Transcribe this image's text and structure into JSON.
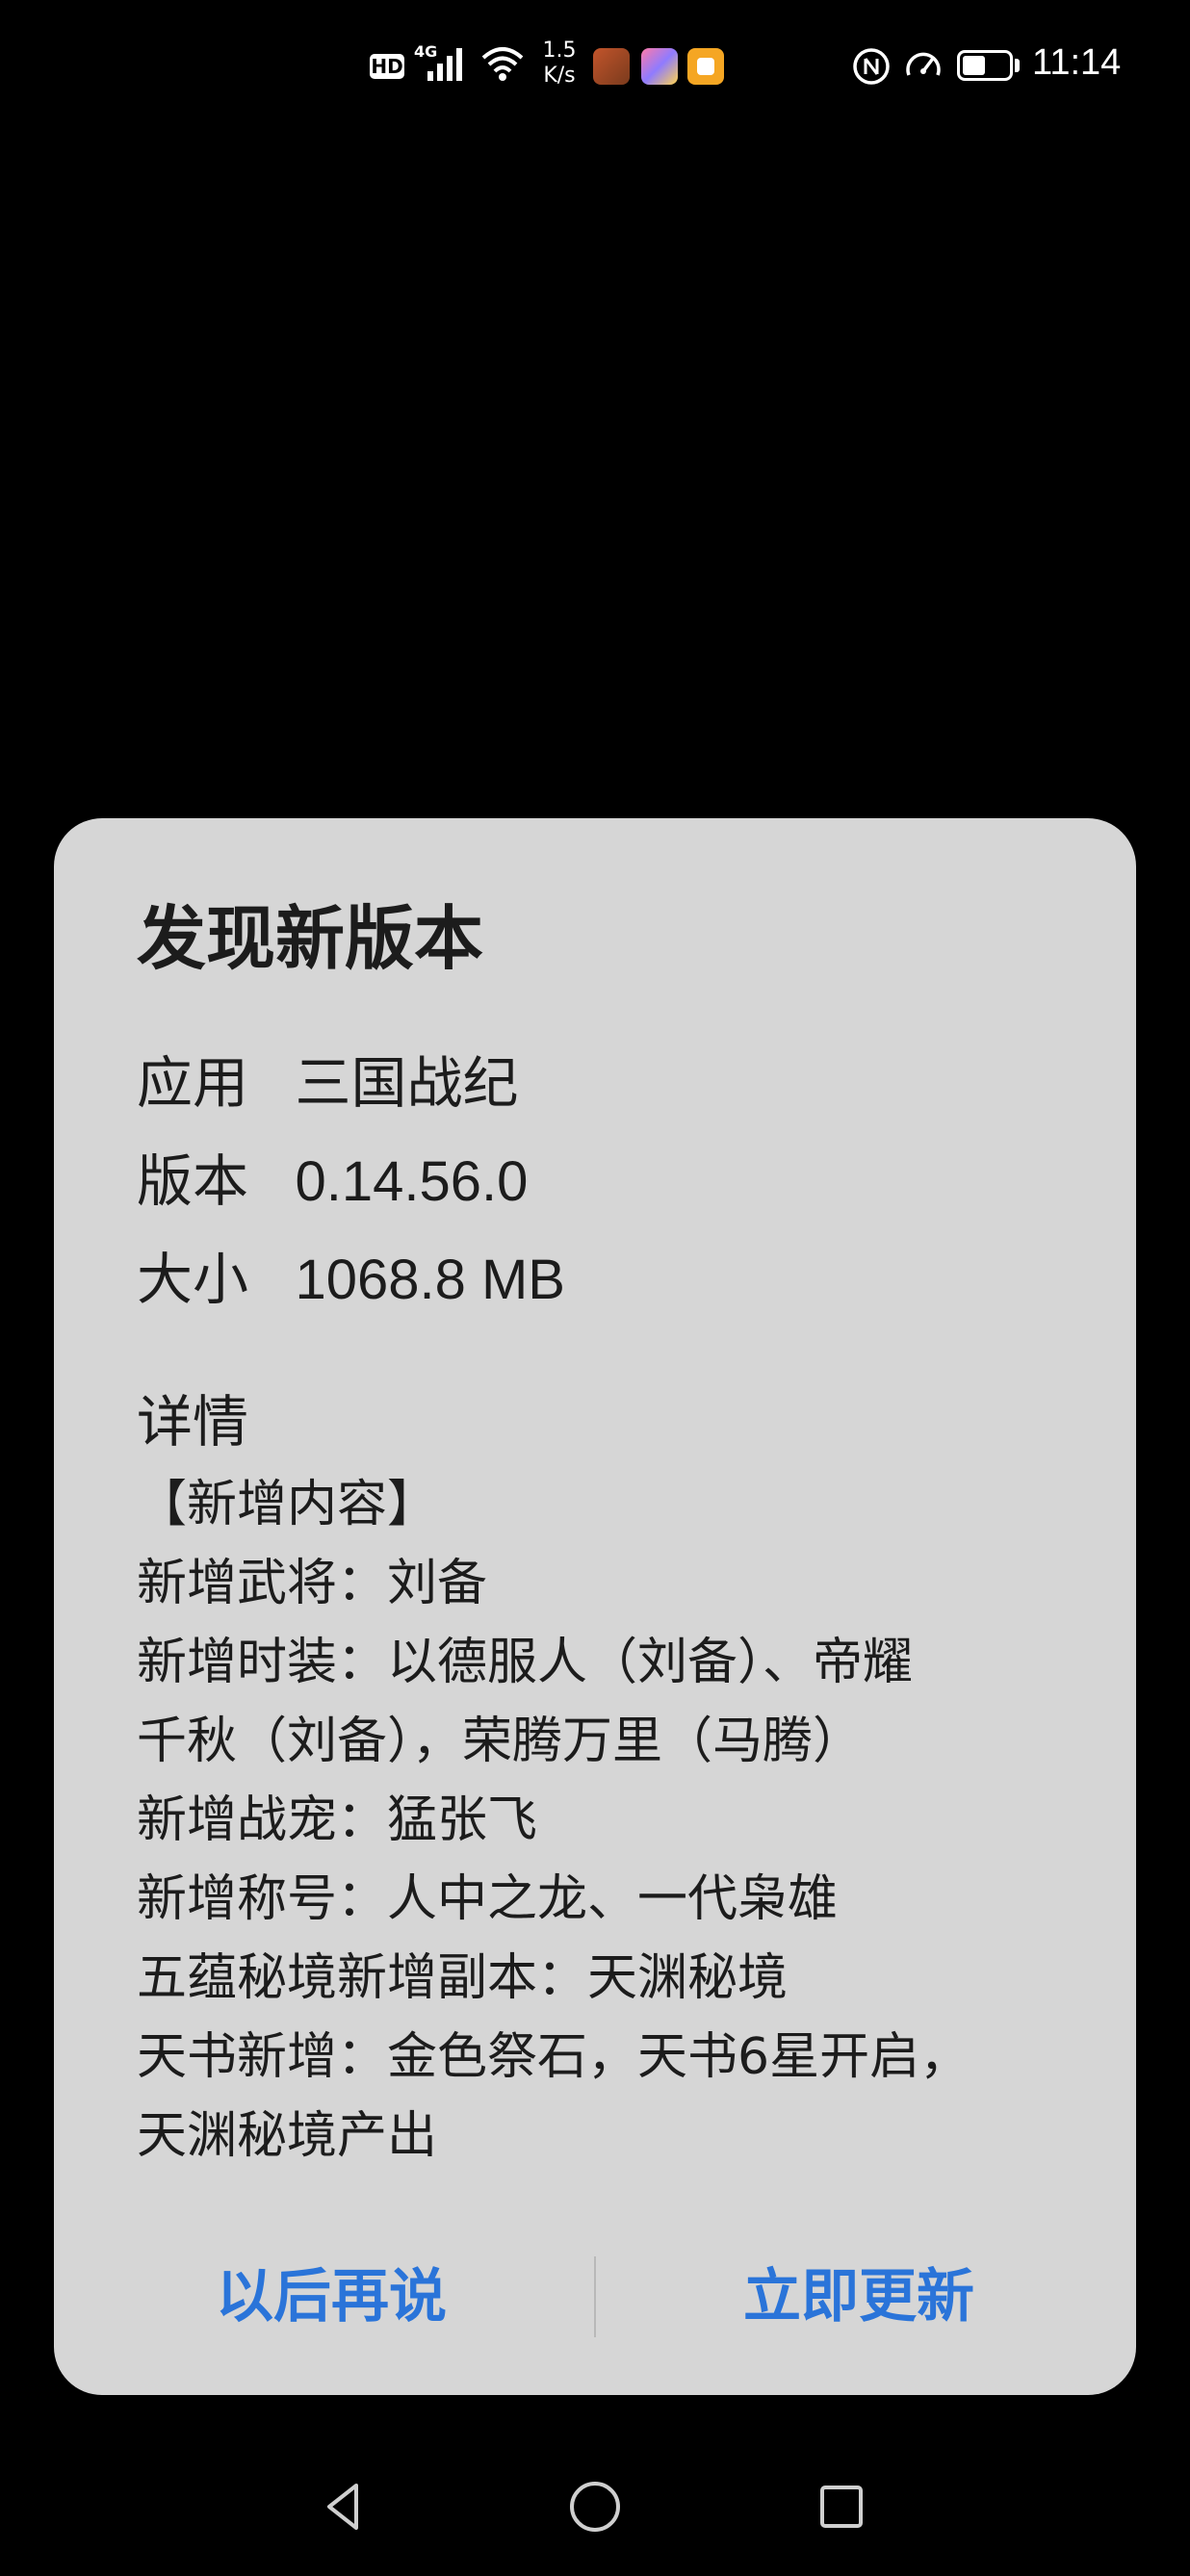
{
  "status_bar": {
    "hd_label": "HD",
    "network_label": "4G",
    "speed_value": "1.5",
    "speed_unit": "K/s",
    "battery_level": 0.55,
    "time": "11:14",
    "icons": [
      "hd-icon",
      "cellular-signal-icon",
      "wifi-icon",
      "game-app-icon",
      "gallery-app-icon",
      "notes-app-icon",
      "nfc-icon",
      "speed-gauge-icon",
      "battery-icon"
    ]
  },
  "dialog": {
    "title": "发现新版本",
    "app_label": "应用",
    "app_value": "三国战纪",
    "version_label": "版本",
    "version_value": "0.14.56.0",
    "size_label": "大小",
    "size_value": "1068.8 MB",
    "details_heading": "详情",
    "details_lines": [
      "【新增内容】",
      "新增武将：刘备",
      "新增时装：以德服人（刘备）、帝耀",
      "千秋（刘备），荣腾万里（马腾）",
      "新增战宠：猛张飞",
      "新增称号：人中之龙、一代枭雄",
      "五蕴秘境新增副本：天渊秘境",
      "天书新增：金色祭石，天书6星开启，",
      "天渊秘境产出"
    ],
    "later_button": "以后再说",
    "update_button": "立即更新",
    "accent_color": "#2a74d9"
  },
  "nav_bar": {
    "icons": [
      "back-icon",
      "home-icon",
      "recent-apps-icon"
    ]
  }
}
